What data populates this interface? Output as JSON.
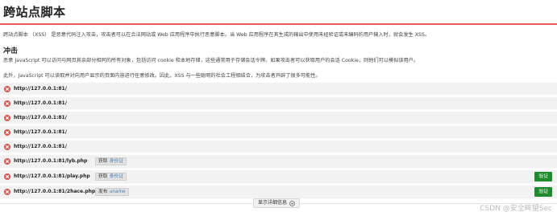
{
  "page": {
    "title": "跨站点脚本",
    "description": "跨站点脚本 （XSS） 是恶意代码注入攻击，攻击者可以在合法网站或 Web 应用程序中执行恶意脚本。当 Web 应用程序在其生成的输出中使用未经验证或未编码的用户输入时，就会发生 XSS。"
  },
  "impact": {
    "heading": "冲击",
    "paragraph1": "恶意 JavaScript 可以访问与网页其余部分相同的所有对象，包括访问 cookie 和本地存储，这些通常用于存储会话令牌。如果攻击者可以获取用户的会话 Cookie，则他们可以模拟该用户。",
    "paragraph2": "此外，JavaScript 可以读取并对向用户显示的页面内容进行任意修改。因此，XSS 与一些聪明的社会工程相结合，为攻击者开辟了很多可能性。"
  },
  "findings": [
    {
      "url": "http://127.0.0.1:81/",
      "tag_key": "",
      "tag_value": "",
      "verify": ""
    },
    {
      "url": "http://127.0.0.1:81/",
      "tag_key": "",
      "tag_value": "",
      "verify": ""
    },
    {
      "url": "http://127.0.0.1:81/",
      "tag_key": "",
      "tag_value": "",
      "verify": ""
    },
    {
      "url": "http://127.0.0.1:81/",
      "tag_key": "",
      "tag_value": "",
      "verify": ""
    },
    {
      "url": "http://127.0.0.1:81/",
      "tag_key": "",
      "tag_value": "",
      "verify": ""
    },
    {
      "url": "http://127.0.0.1:81/lyb.php",
      "tag_key": "获取",
      "tag_value": "身份证",
      "verify": ""
    },
    {
      "url": "http://127.0.0.1:81/play.php",
      "tag_key": "获取",
      "tag_value": "身份证",
      "verify": "验证"
    },
    {
      "url": "http://127.0.0.1:81/2hace.php",
      "tag_key": "发布",
      "tag_value": "uname",
      "verify": "验证"
    }
  ],
  "details_button": "显示详细信息",
  "watermark": "CSDN @安全眸望Sec",
  "icons": {
    "finding_status": "error-x-icon",
    "details_toggle": "chevron-down-icon"
  },
  "colors": {
    "title_rule": "#e35d5d",
    "error": "#d9534f",
    "verify": "#1f8a2e"
  }
}
